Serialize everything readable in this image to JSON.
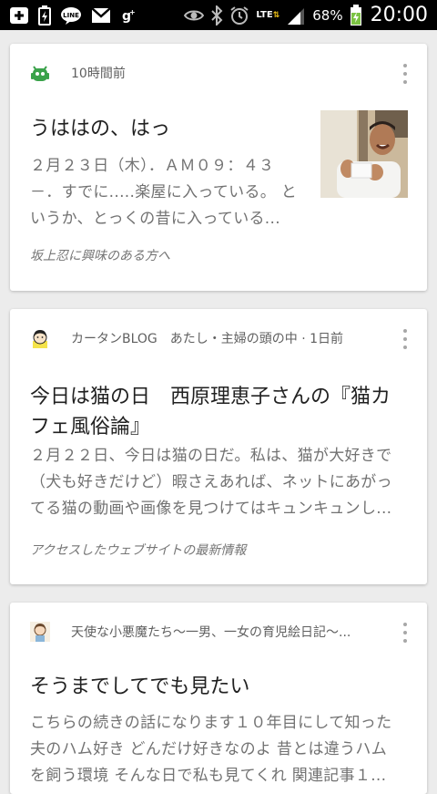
{
  "status_bar": {
    "battery_percent": "68%",
    "time": "20:00",
    "network": "LTE",
    "icons": [
      "plus-box-icon",
      "battery-small-icon",
      "line-app-icon",
      "gmail-icon",
      "google-plus-icon",
      "eye-icon",
      "bluetooth-icon",
      "alarm-icon",
      "signal-icon",
      "battery-charging-icon"
    ]
  },
  "cards": [
    {
      "source": "10時間前",
      "title": "うははの、はっ",
      "snippet_lines": [
        "２月２３日（木）．ＡＭ０９：４３",
        "－．すでに.....楽屋に入っている。 と",
        "いうか、とっくの昔に入っている..."
      ],
      "reason": "坂上忍に興味のある方へ"
    },
    {
      "source": "カータンBLOG　あたし・主婦の頭の中 · 1日前",
      "title_lines": [
        "今日は猫の日　西原理恵子さんの『猫カ",
        "フェ風俗論』"
      ],
      "snippet_lines": [
        "２月２２日、今日は猫の日だ。私は、猫が大好きで",
        "（犬も好きだけど）暇さえあれば、ネットにあがっ",
        "てる猫の動画や画像を見つけてはキュンキュンし..."
      ],
      "reason": "アクセスしたウェブサイトの最新情報"
    },
    {
      "source": "天使な小悪魔たち〜一男、一女の育児絵日記〜...",
      "title": "そうまでしてでも見たい",
      "snippet_lines": [
        "こちらの続きの話になります１０年目にして知った",
        "夫のハム好き どんだけ好きなのよ 昔とは違うハム",
        "を飼う環境 そんな日で私も見てくれ 関連記事１..."
      ]
    }
  ]
}
